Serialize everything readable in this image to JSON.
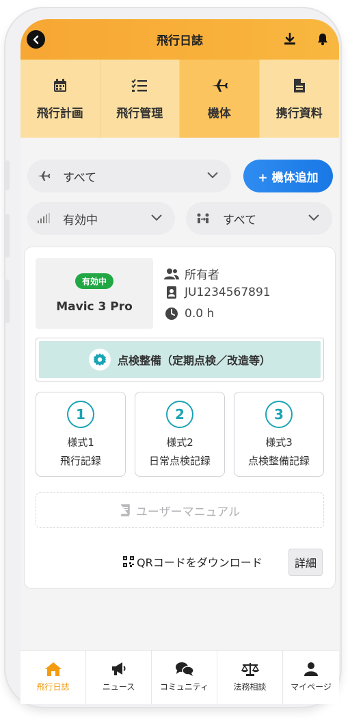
{
  "header": {
    "title": "飛行日誌",
    "accent_color": "#f7a733",
    "icons": [
      "back-arrow-icon",
      "download-icon",
      "bell-icon"
    ]
  },
  "tabs": [
    {
      "label": "飛行計画",
      "icon": "calendar-icon",
      "active": false
    },
    {
      "label": "飛行管理",
      "icon": "checklist-icon",
      "active": false
    },
    {
      "label": "機体",
      "icon": "airplane-icon",
      "active": true
    },
    {
      "label": "携行資料",
      "icon": "document-icon",
      "active": false
    }
  ],
  "filters": {
    "type_value": "すべて",
    "status_value": "有効中",
    "owner_value": "すべて"
  },
  "add_button": {
    "label": "+ 機体追加",
    "color": "#1a78e6"
  },
  "aircraft": {
    "status_badge": "有効中",
    "status_color": "#22a745",
    "model": "Mavic 3 Pro",
    "owner_label": "所有者",
    "registration": "JU1234567891",
    "flight_time": "0.0 h"
  },
  "maintenance_button": "点検整備（定期点検／改造等）",
  "forms": [
    {
      "number": "1",
      "line1": "様式1",
      "line2": "飛行記録"
    },
    {
      "number": "2",
      "line1": "様式2",
      "line2": "日常点検記録"
    },
    {
      "number": "3",
      "line1": "様式3",
      "line2": "点検整備記録"
    }
  ],
  "manual_button": "ユーザーマニュアル",
  "qr_download": "QRコードをダウンロード",
  "detail_button": "詳細",
  "bottom_nav": [
    {
      "label": "飛行日誌",
      "icon": "home-icon",
      "active": true
    },
    {
      "label": "ニュース",
      "icon": "megaphone-icon",
      "active": false
    },
    {
      "label": "コミュニティ",
      "icon": "chat-bubbles-icon",
      "active": false
    },
    {
      "label": "法務相談",
      "icon": "scales-icon",
      "active": false
    },
    {
      "label": "マイページ",
      "icon": "user-icon",
      "active": false
    }
  ]
}
